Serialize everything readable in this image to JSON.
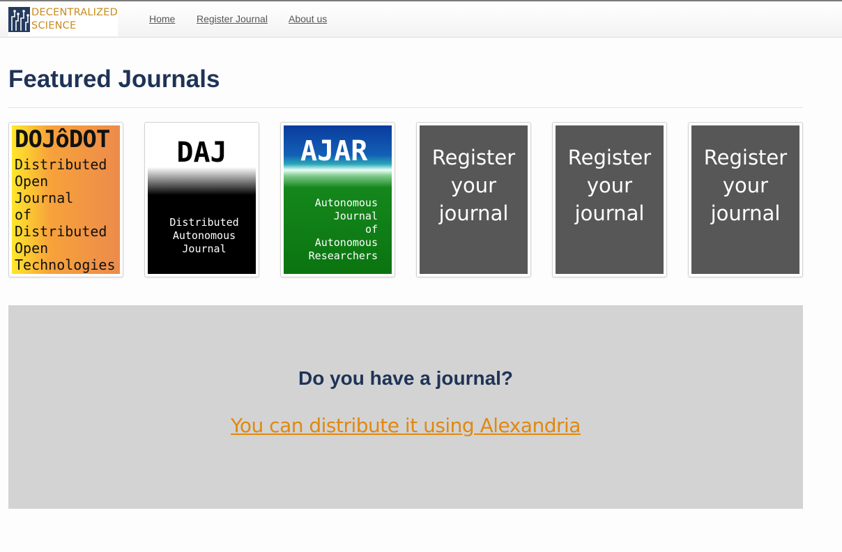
{
  "brand": {
    "line1": "DECENTRALIZED",
    "line2": "SCIENCE",
    "colors": {
      "navy": "#243b5e",
      "gold": "#c98b1d"
    }
  },
  "nav": {
    "items": [
      "Home",
      "Register Journal",
      "About us"
    ]
  },
  "page_title": "Featured Journals",
  "journals": [
    {
      "title": "DOJôDOT",
      "subtitle": "Distributed\nOpen\nJournal\nof\nDistributed\nOpen\nTechnologies"
    },
    {
      "title": "DAJ",
      "subtitle": "Distributed\nAutonomous\nJournal"
    },
    {
      "title": "AJAR",
      "subtitle": "Autonomous\nJournal\nof\nAutonomous\nResearchers"
    },
    {
      "label": "Register your journal"
    },
    {
      "label": "Register your journal"
    },
    {
      "label": "Register your journal"
    }
  ],
  "cta": {
    "title": "Do you have a journal?",
    "link": "You can distribute it using Alexandria",
    "link_color": "#e0880f"
  }
}
